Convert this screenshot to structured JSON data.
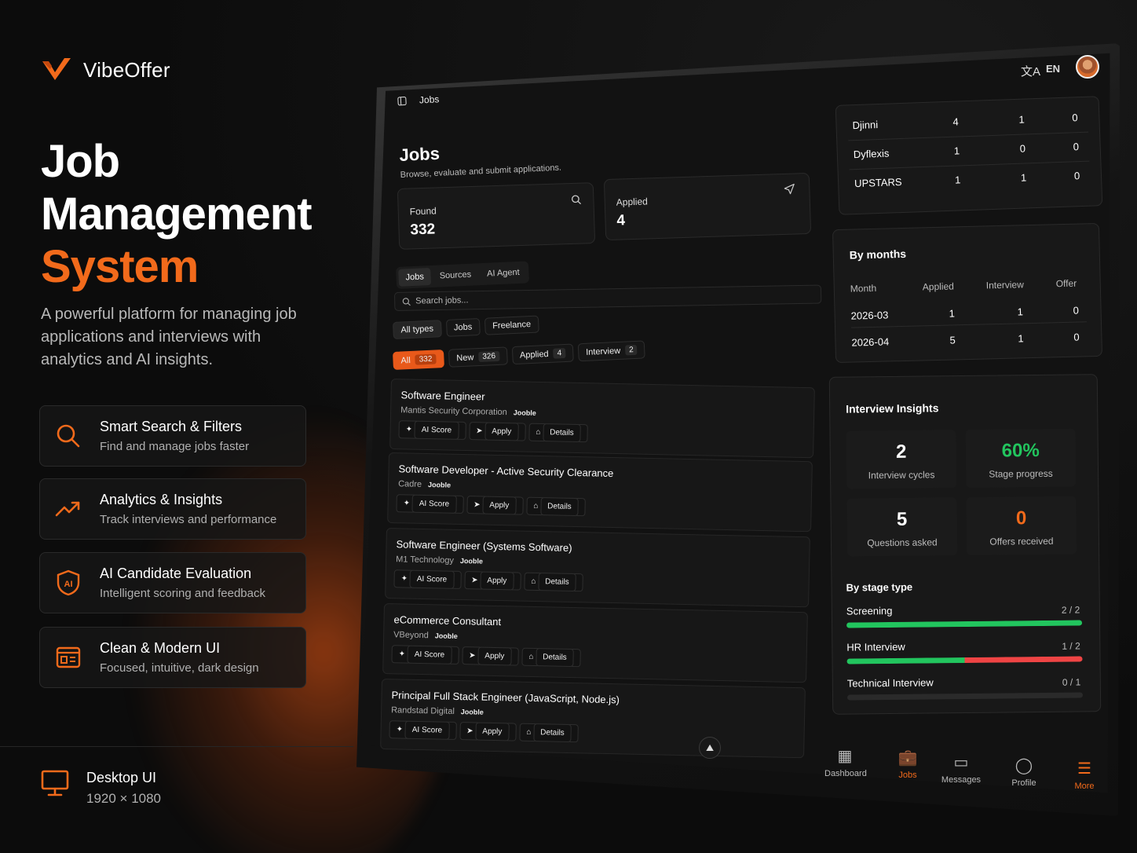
{
  "brand": {
    "name": "VibeOffer"
  },
  "hero": {
    "line1": "Job",
    "line2": "Management",
    "line3": "System"
  },
  "description": "A powerful platform for managing job applications and interviews with analytics and AI insights.",
  "features": [
    {
      "title": "Smart Search & Filters",
      "subtitle": "Find and manage jobs faster",
      "icon": "search-icon"
    },
    {
      "title": "Analytics & Insights",
      "subtitle": "Track interviews and performance",
      "icon": "trending-up-icon"
    },
    {
      "title": "AI Candidate Evaluation",
      "subtitle": "Intelligent scoring and feedback",
      "icon": "ai-shield-icon"
    },
    {
      "title": "Clean & Modern UI",
      "subtitle": "Focused, intuitive, dark design",
      "icon": "layout-icon"
    }
  ],
  "platform": {
    "title": "Desktop UI",
    "resolution": "1920 × 1080"
  },
  "app": {
    "breadcrumb": "Jobs",
    "language": "EN",
    "page_title": "Jobs",
    "page_subtitle": "Browse, evaluate and submit applications.",
    "found_label": "Found",
    "found_value": "332",
    "applied_label": "Applied",
    "applied_value": "4",
    "tabs": [
      "Jobs",
      "Sources",
      "AI Agent"
    ],
    "search_placeholder": "Search jobs...",
    "type_filters": [
      "All types",
      "Jobs",
      "Freelance"
    ],
    "status_filters": [
      {
        "label": "All",
        "count": "332"
      },
      {
        "label": "New",
        "count": "326"
      },
      {
        "label": "Applied",
        "count": "4"
      },
      {
        "label": "Interview",
        "count": "2"
      }
    ],
    "jobs": [
      {
        "title": "Software Engineer",
        "company": "Mantis Security Corporation",
        "source": "Jooble"
      },
      {
        "title": "Software Developer - Active Security Clearance",
        "company": "Cadre",
        "source": "Jooble"
      },
      {
        "title": "Software Engineer (Systems Software)",
        "company": "M1 Technology",
        "source": "Jooble"
      },
      {
        "title": "eCommerce Consultant",
        "company": "VBeyond",
        "source": "Jooble"
      },
      {
        "title": "Principal Full Stack Engineer (JavaScript, Node.js)",
        "company": "Randstad Digital",
        "source": "Jooble"
      }
    ],
    "job_actions": [
      "AI Score",
      "Apply",
      "Details"
    ],
    "sources_table": [
      {
        "name": "Djinni",
        "a": "4",
        "b": "1",
        "c": "0"
      },
      {
        "name": "Dyflexis",
        "a": "1",
        "b": "0",
        "c": "0"
      },
      {
        "name": "UPSTARS",
        "a": "1",
        "b": "1",
        "c": "0"
      }
    ],
    "by_months": {
      "title": "By months",
      "headers": [
        "Month",
        "Applied",
        "Interview",
        "Offer"
      ],
      "rows": [
        {
          "month": "2026-03",
          "applied": "1",
          "interview": "1",
          "offer": "0"
        },
        {
          "month": "2026-04",
          "applied": "5",
          "interview": "1",
          "offer": "0"
        }
      ]
    },
    "insights": {
      "title": "Interview Insights",
      "stats": [
        {
          "value": "2",
          "label": "Interview cycles",
          "color": "#ffffff"
        },
        {
          "value": "60%",
          "label": "Stage progress",
          "color": "#22c55e"
        },
        {
          "value": "5",
          "label": "Questions asked",
          "color": "#ffffff"
        },
        {
          "value": "0",
          "label": "Offers received",
          "color": "#f26a1b"
        }
      ],
      "stage_title": "By stage type",
      "stages": [
        {
          "name": "Screening",
          "ratio": "2 / 2",
          "green": 1.0,
          "red": 0
        },
        {
          "name": "HR Interview",
          "ratio": "1 / 2",
          "green": 0.5,
          "red": 0.5
        },
        {
          "name": "Technical Interview",
          "ratio": "0 / 1",
          "green": 0,
          "red": 0
        }
      ]
    },
    "bottom_nav": [
      {
        "label": "Dashboard",
        "icon": "grid-icon"
      },
      {
        "label": "Jobs",
        "icon": "briefcase-icon",
        "active": true
      },
      {
        "label": "Messages",
        "icon": "chat-icon"
      },
      {
        "label": "Profile",
        "icon": "user-icon"
      },
      {
        "label": "More",
        "icon": "menu-icon"
      }
    ]
  },
  "colors": {
    "accent": "#f26a1b",
    "success": "#22c55e",
    "danger": "#ef4444"
  }
}
